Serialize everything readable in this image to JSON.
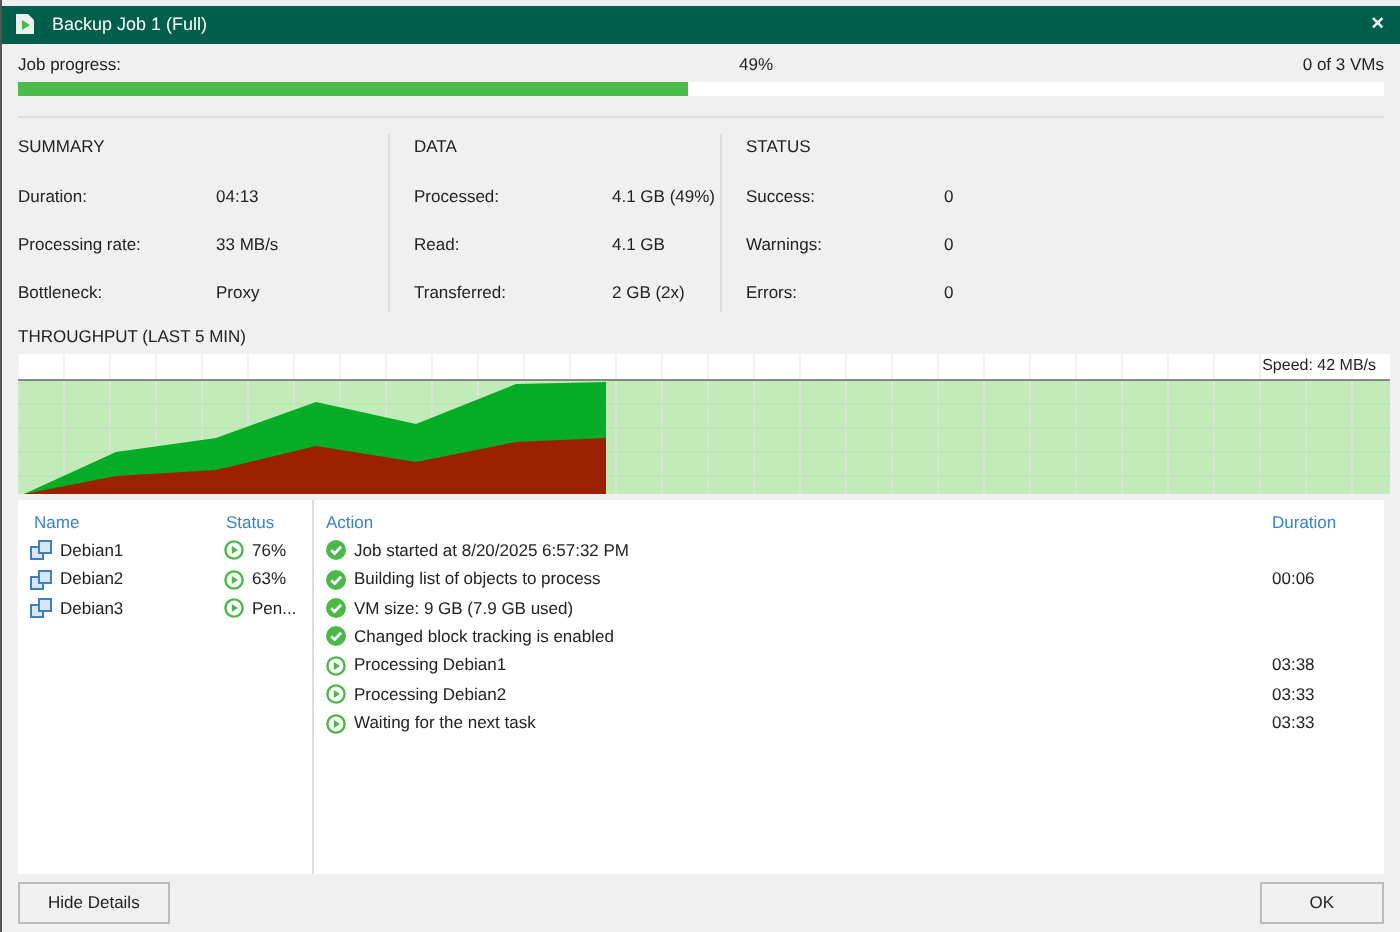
{
  "window": {
    "title": "Backup Job 1 (Full)",
    "close": "×"
  },
  "job_progress": {
    "label": "Job progress:",
    "level": 0.49,
    "percent": "49%",
    "count": "0 of 3 VMs"
  },
  "sections": [
    {
      "heading": "SUMMARY",
      "rows": [
        {
          "label": "Duration:",
          "value": "04:13"
        },
        {
          "label": "Processing rate:",
          "value": "33 MB/s"
        },
        {
          "label": "Bottleneck:",
          "value": "Proxy"
        }
      ]
    },
    {
      "heading": "DATA",
      "rows": [
        {
          "label": "Processed:",
          "value": "4.1 GB (49%)"
        },
        {
          "label": "Read:",
          "value": "4.1 GB"
        },
        {
          "label": "Transferred:",
          "value": "2 GB (2x)"
        }
      ]
    },
    {
      "heading": "STATUS",
      "rows": [
        {
          "label": "Success:",
          "value": "0"
        },
        {
          "label": "Warnings:",
          "value": "0"
        },
        {
          "label": "Errors:",
          "value": "0"
        }
      ]
    }
  ],
  "throughput": {
    "heading": "THROUGHPUT (LAST 5 MIN)",
    "speed": "Speed: 42 MB/s"
  },
  "vm_table": {
    "columns": [
      "Name",
      "Status"
    ],
    "rows": [
      {
        "name": "Debian1",
        "status": "76%",
        "kind": "running"
      },
      {
        "name": "Debian2",
        "status": "63%",
        "kind": "running"
      },
      {
        "name": "Debian3",
        "status": "Pen...",
        "kind": "running"
      }
    ]
  },
  "log_table": {
    "columns": [
      "Action",
      "Duration"
    ],
    "rows": [
      {
        "action": "Job started at 8/20/2025 6:57:32 PM",
        "kind": "done"
      },
      {
        "action": "Building list of objects to process",
        "duration": "00:06",
        "kind": "done"
      },
      {
        "action": "VM size: 9 GB (7.9 GB used)",
        "kind": "done"
      },
      {
        "action": "Changed block tracking is enabled",
        "kind": "done"
      },
      {
        "action": "Processing Debian1",
        "duration": "03:38",
        "kind": "running"
      },
      {
        "action": "Processing Debian2",
        "duration": "03:33",
        "kind": "running"
      },
      {
        "action": "Waiting for the next task",
        "duration": "03:33",
        "kind": "running"
      }
    ]
  },
  "buttons": [
    "Hide Details",
    "OK"
  ]
}
